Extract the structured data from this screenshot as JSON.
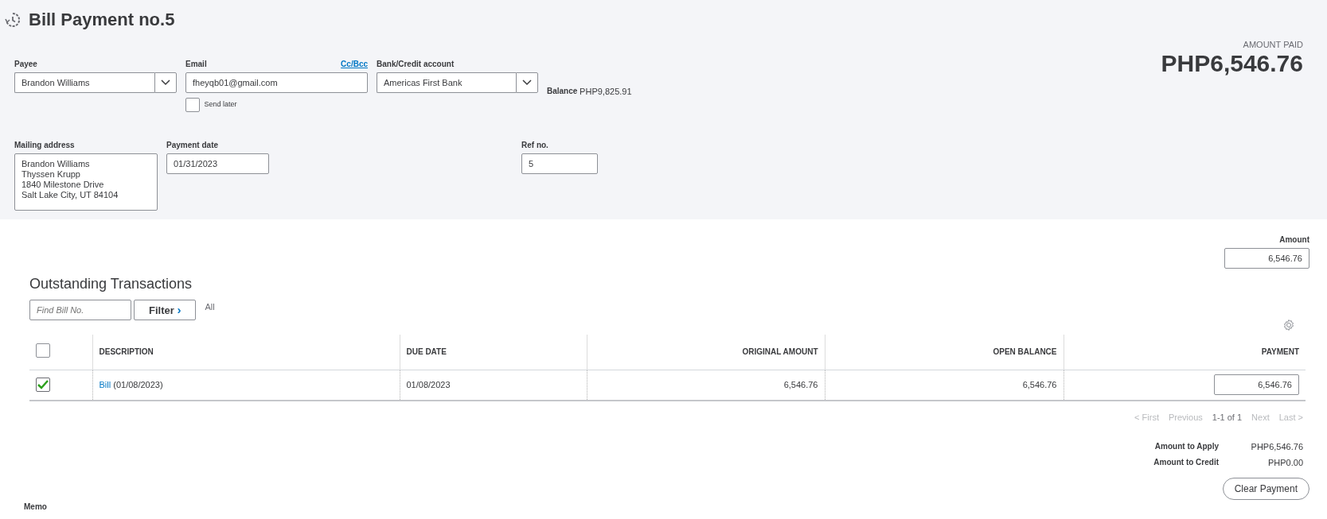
{
  "header": {
    "title": "Bill Payment no.5",
    "amount_paid_label": "AMOUNT PAID",
    "amount_paid": "PHP6,546.76"
  },
  "payee": {
    "label": "Payee",
    "value": "Brandon Williams"
  },
  "email": {
    "label": "Email",
    "link": "Cc/Bcc",
    "value": "fheyqb01@gmail.com",
    "send_later": {
      "label": "Send later",
      "checked": false
    }
  },
  "bank_account": {
    "label": "Bank/Credit account",
    "value": "Americas First Bank",
    "balance_label": "Balance",
    "balance": "PHP9,825.91"
  },
  "mailing_address": {
    "label": "Mailing address",
    "lines": [
      "Brandon Williams",
      "Thyssen Krupp",
      "1840 Milestone Drive",
      "Salt Lake City, UT  84104"
    ]
  },
  "payment_date": {
    "label": "Payment date",
    "value": "01/31/2023"
  },
  "ref_no": {
    "label": "Ref no.",
    "value": "5"
  },
  "amount": {
    "label": "Amount",
    "value": "6,546.76"
  },
  "outstanding": {
    "title": "Outstanding Transactions",
    "search_placeholder": "Find Bill No.",
    "filter_button": "Filter",
    "filter_chevron": "›",
    "filter_value": "All",
    "select_all_checked": false,
    "columns": [
      "DESCRIPTION",
      "DUE DATE",
      "ORIGINAL AMOUNT",
      "OPEN BALANCE",
      "PAYMENT"
    ],
    "rows": [
      {
        "checked": true,
        "link": "Bill",
        "description": "(01/08/2023)",
        "due_date": "01/08/2023",
        "original_amount": "6,546.76",
        "open_balance": "6,546.76",
        "payment": "6,546.76"
      }
    ],
    "pagination": [
      {
        "label": "< First",
        "disabled": true
      },
      {
        "label": "Previous",
        "disabled": true
      },
      {
        "label": "1-1 of 1",
        "disabled": false
      },
      {
        "label": "Next",
        "disabled": true
      },
      {
        "label": "Last >",
        "disabled": true
      }
    ]
  },
  "totals": [
    {
      "label": "Amount to Apply",
      "value": "PHP6,546.76"
    },
    {
      "label": "Amount to Credit",
      "value": "PHP0.00"
    }
  ],
  "clear_button": "Clear Payment",
  "memo_label": "Memo"
}
